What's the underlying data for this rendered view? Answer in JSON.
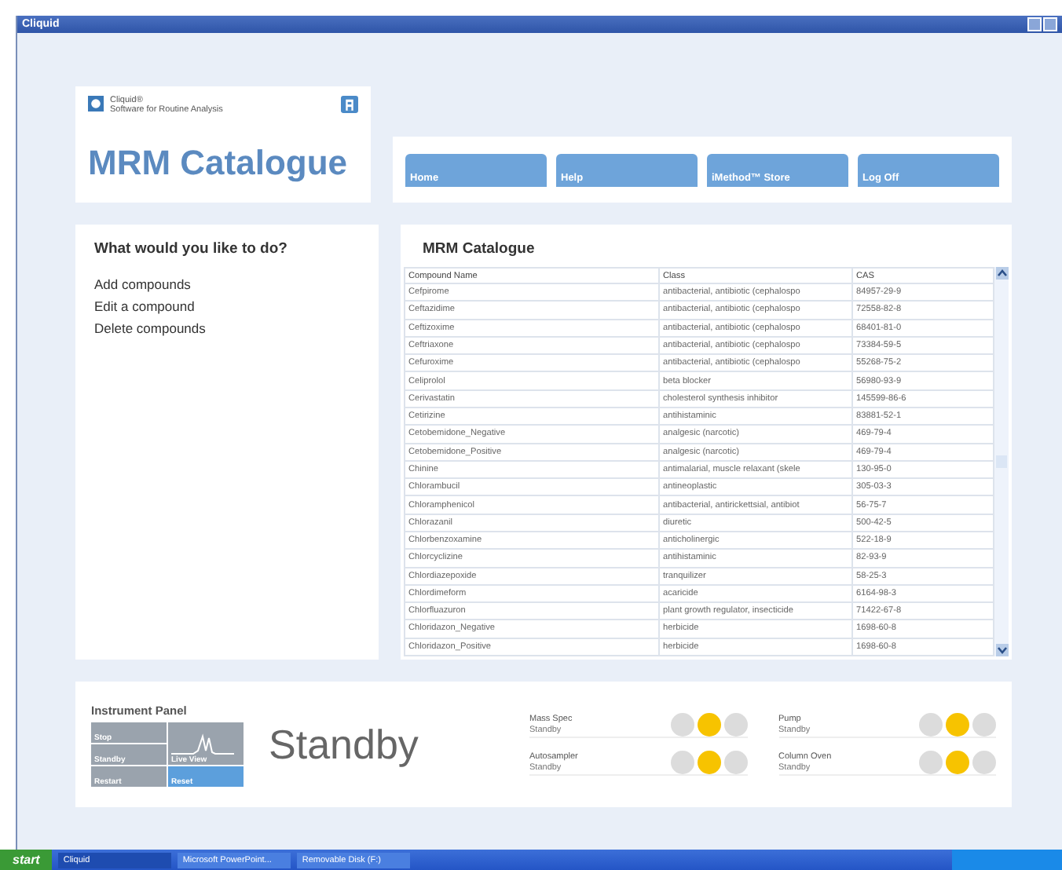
{
  "window": {
    "title": "Cliquid"
  },
  "header": {
    "brand": "Cliquid®",
    "tagline": "Software for Routine Analysis",
    "title": "MRM Catalogue"
  },
  "nav": [
    "Home",
    "Help",
    "iMethod™ Store",
    "Log Off"
  ],
  "tasks": {
    "title": "What would you like to do?",
    "items": [
      "Add compounds",
      "Edit a compound",
      "Delete compounds"
    ]
  },
  "catalogue": {
    "title": "MRM Catalogue",
    "columns": [
      "Compound Name",
      "Class",
      "CAS"
    ],
    "rows": [
      [
        "Cefpirome",
        "antibacterial, antibiotic (cephalospo",
        "84957-29-9"
      ],
      [
        "Ceftazidime",
        "antibacterial, antibiotic (cephalospo",
        "72558-82-8"
      ],
      [
        "Ceftizoxime",
        "antibacterial, antibiotic (cephalospo",
        "68401-81-0"
      ],
      [
        "Ceftriaxone",
        "antibacterial, antibiotic (cephalospo",
        "73384-59-5"
      ],
      [
        "Cefuroxime",
        "antibacterial, antibiotic (cephalospo",
        "55268-75-2"
      ],
      [
        "Celiprolol",
        "beta blocker",
        "56980-93-9"
      ],
      [
        "Cerivastatin",
        "cholesterol synthesis inhibitor",
        "145599-86-6"
      ],
      [
        "Cetirizine",
        "antihistaminic",
        "83881-52-1"
      ],
      [
        "Cetobemidone_Negative",
        "analgesic (narcotic)",
        "469-79-4"
      ],
      [
        "Cetobemidone_Positive",
        "analgesic (narcotic)",
        "469-79-4"
      ],
      [
        "Chinine",
        "antimalarial, muscle relaxant (skele",
        "130-95-0"
      ],
      [
        "Chlorambucil",
        "antineoplastic",
        "305-03-3"
      ],
      [
        "Chloramphenicol",
        "antibacterial, antirickettsial, antibiot",
        "56-75-7"
      ],
      [
        "Chlorazanil",
        "diuretic",
        "500-42-5"
      ],
      [
        "Chlorbenzoxamine",
        "anticholinergic",
        "522-18-9"
      ],
      [
        "Chlorcyclizine",
        "antihistaminic",
        "82-93-9"
      ],
      [
        "Chlordiazepoxide",
        "tranquilizer",
        "58-25-3"
      ],
      [
        "Chlordimeform",
        "acaricide",
        "6164-98-3"
      ],
      [
        "Chlorfluazuron",
        "plant growth regulator, insecticide",
        "71422-67-8"
      ],
      [
        "Chloridazon_Negative",
        "herbicide",
        "1698-60-8"
      ],
      [
        "Chloridazon_Positive",
        "herbicide",
        "1698-60-8"
      ]
    ]
  },
  "instrument_panel": {
    "title": "Instrument Panel",
    "status": "Standby",
    "buttons": [
      {
        "label": "Stop",
        "selected": false
      },
      {
        "label": "Standby",
        "selected": false
      },
      {
        "label": "Restart",
        "selected": false
      },
      {
        "label": "Live View",
        "kind": "chart",
        "selected": false
      },
      {
        "label": "Reset",
        "selected": true
      }
    ],
    "devices": [
      {
        "name": "Mass Spec",
        "state": "Standby",
        "lights": [
          {
            "on": false
          },
          {
            "on": true
          },
          {
            "on": false
          }
        ]
      },
      {
        "name": "Pump",
        "state": "Standby",
        "lights": [
          {
            "on": false
          },
          {
            "on": true
          },
          {
            "on": false
          }
        ]
      },
      {
        "name": "Autosampler",
        "state": "Standby",
        "lights": [
          {
            "on": false
          },
          {
            "on": true
          },
          {
            "on": false
          }
        ]
      },
      {
        "name": "Column Oven",
        "state": "Standby",
        "lights": [
          {
            "on": false
          },
          {
            "on": true
          },
          {
            "on": false
          }
        ]
      }
    ]
  },
  "taskbar": {
    "start": "start",
    "tasks": [
      {
        "label": "Cliquid",
        "selected": true
      },
      {
        "label": "Microsoft PowerPoint...",
        "selected": false
      },
      {
        "label": "Removable Disk (F:)",
        "selected": false
      }
    ]
  }
}
